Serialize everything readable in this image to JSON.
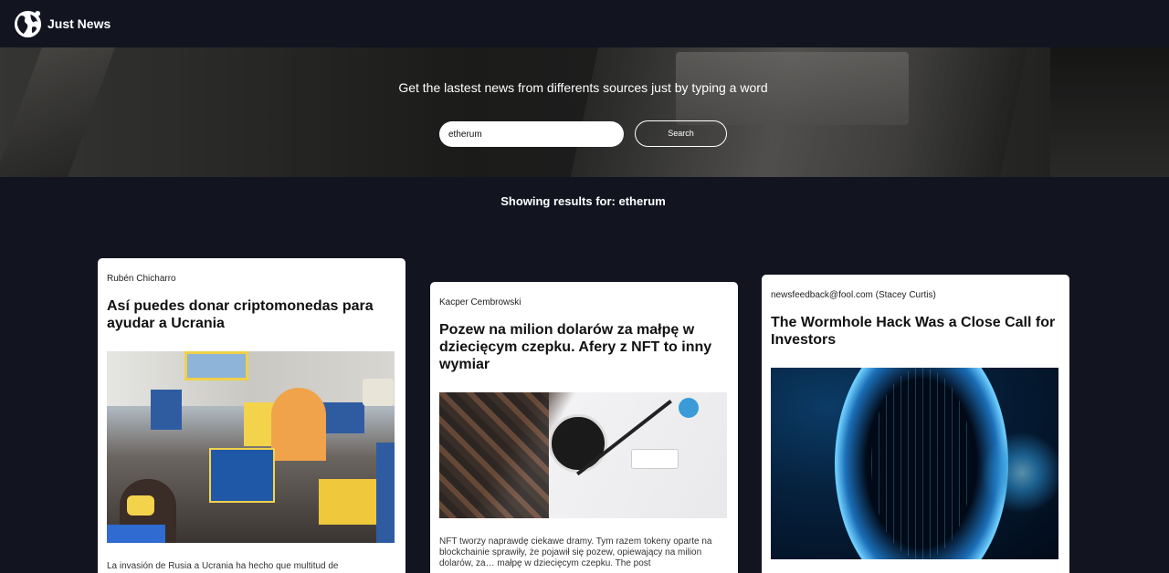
{
  "navbar": {
    "brand": "Just News",
    "logo_icon": "globe-icon"
  },
  "hero": {
    "tagline": "Get the lastest news from differents sources just by typing a word",
    "search_value": "etherum",
    "search_button": "Search"
  },
  "results": {
    "label": "Showing results for: etherum"
  },
  "articles": [
    {
      "author": "Rubén Chicharro",
      "title": "Así puedes donar criptomonedas para ayudar a Ucrania",
      "image": "ukraine-protest-photo",
      "description": "La invasión de Rusia a Ucrania ha hecho que multitud de"
    },
    {
      "author": "Kacper Cembrowski",
      "title": "Pozew na milion dolarów za małpę w dziecięcym czepku. Afery z NFT to inny wymiar",
      "image": "bored-ape-yacht-club-photo",
      "description": "NFT tworzy naprawdę ciekawe dramy. Tym razem tokeny oparte na blockchainie sprawiły, że pojawił się pozew, opiewający na milion dolarów, za… małpę w dziecięcym czepku. The post"
    },
    {
      "author": "newsfeedback@fool.com (Stacey Curtis)",
      "title": "The Wormhole Hack Was a Close Call for Investors",
      "image": "wormhole-illustration"
    }
  ],
  "colors": {
    "background": "#121420",
    "card": "#ffffff",
    "accent_blue": "#3a9bd6"
  }
}
